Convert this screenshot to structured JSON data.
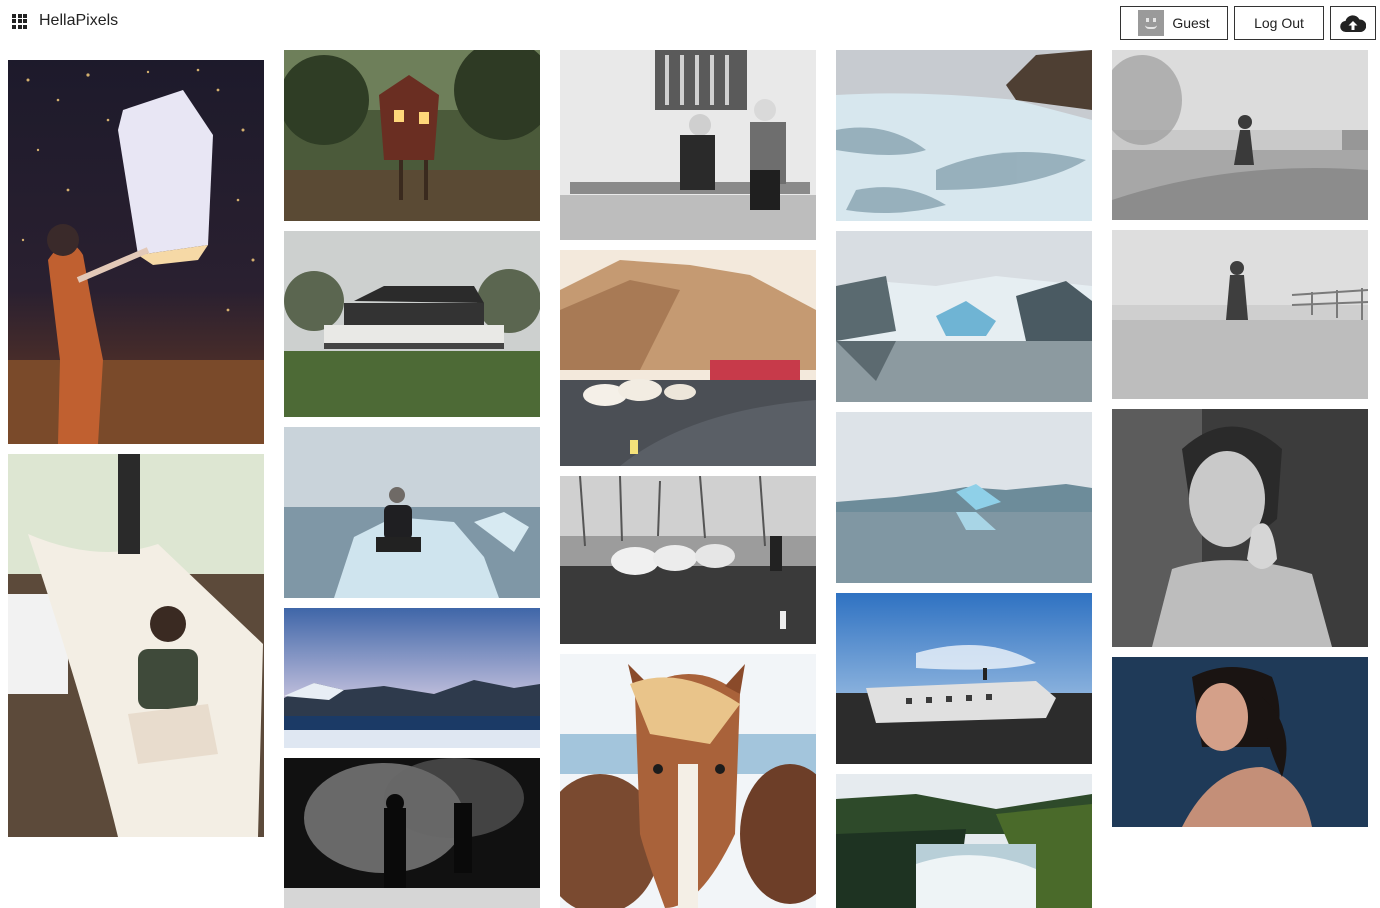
{
  "app": {
    "name": "HellaPixels",
    "logo_icon": "grid-logo-icon"
  },
  "header": {
    "guest_label": "Guest",
    "guest_icon": "avatar-icon",
    "logout_label": "Log Out",
    "upload_icon": "cloud-upload-icon"
  },
  "gallery": {
    "columns": 5,
    "photos": [
      {
        "subject": "woman releasing sky lantern at night"
      },
      {
        "subject": "woman in white hammock"
      },
      {
        "subject": "treehouse in forest"
      },
      {
        "subject": "farmhouse with porch"
      },
      {
        "subject": "man sitting on iceberg"
      },
      {
        "subject": "mountain lake at dusk"
      },
      {
        "subject": "people in steam black and white"
      },
      {
        "subject": "elderly couple on bench black and white"
      },
      {
        "subject": "sheep on road with mountain"
      },
      {
        "subject": "sheep on road black and white"
      },
      {
        "subject": "horse with blond mane"
      },
      {
        "subject": "glacier ice field"
      },
      {
        "subject": "glacier lagoon icebergs"
      },
      {
        "subject": "iceberg reflection"
      },
      {
        "subject": "plane wreck on black sand"
      },
      {
        "subject": "waterfall canyon"
      },
      {
        "subject": "girl jumping in fog"
      },
      {
        "subject": "girl jumping in fog near fence"
      },
      {
        "subject": "black and white portrait of woman"
      },
      {
        "subject": "portrait of woman blue background"
      }
    ]
  }
}
